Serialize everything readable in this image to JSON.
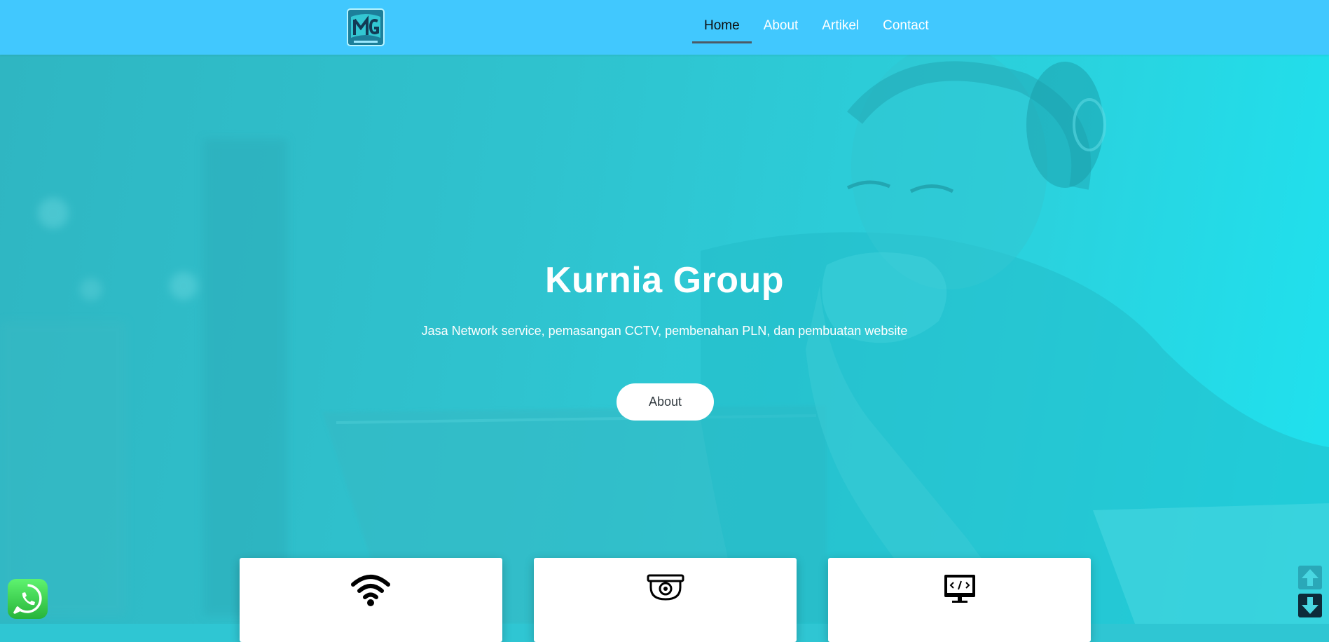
{
  "nav": {
    "logo_alt": "KG logo",
    "items": [
      {
        "label": "Home",
        "active": true
      },
      {
        "label": "About",
        "active": false
      },
      {
        "label": "Artikel",
        "active": false
      },
      {
        "label": "Contact",
        "active": false
      }
    ]
  },
  "hero": {
    "title": "Kurnia Group",
    "subtitle": "Jasa Network service, pemasangan CCTV, pembenahan PLN, dan pembuatan website",
    "button_label": "About"
  },
  "services": [
    {
      "icon": "wifi-icon"
    },
    {
      "icon": "cctv-camera-icon"
    },
    {
      "icon": "web-code-icon"
    }
  ],
  "floating": {
    "whatsapp_icon": "whatsapp-icon",
    "scroll_up_icon": "arrow-up-icon",
    "scroll_down_icon": "arrow-down-icon"
  },
  "colors": {
    "navbar": "#41c8fe",
    "hero_overlay": "#2fc6d3",
    "active_underline": "#4c5a66",
    "whatsapp": "#27b43a"
  }
}
